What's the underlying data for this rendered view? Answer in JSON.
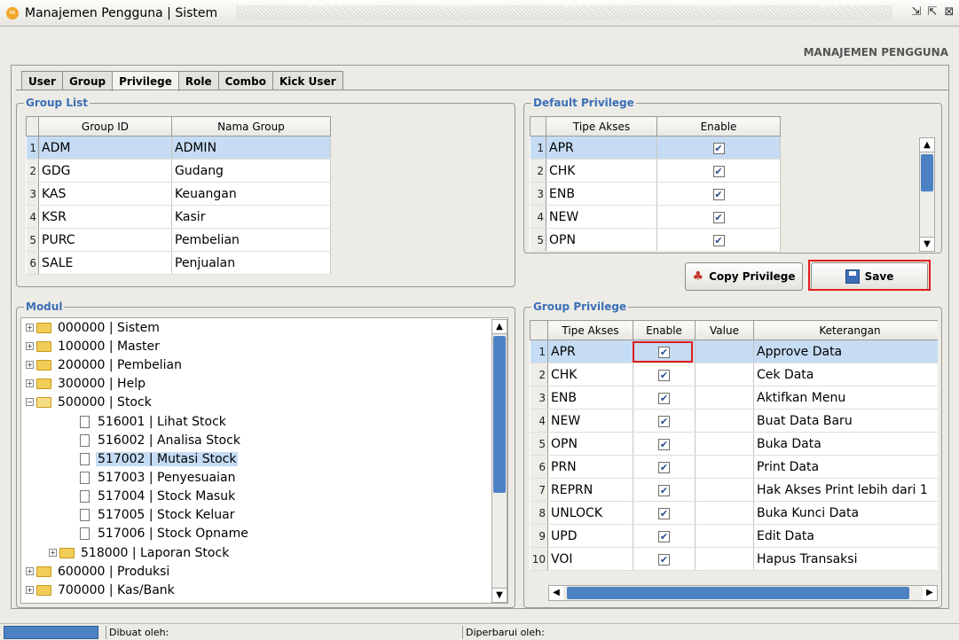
{
  "window": {
    "title": "Manajemen Pengguna | Sistem",
    "restore_glyph": "⇲",
    "max_glyph": "⇱",
    "close_glyph": "⊠"
  },
  "header": {
    "label": "MANAJEMEN PENGGUNA"
  },
  "tabs": [
    {
      "label": "User"
    },
    {
      "label": "Group"
    },
    {
      "label": "Privilege"
    },
    {
      "label": "Role"
    },
    {
      "label": "Combo"
    },
    {
      "label": "Kick User"
    }
  ],
  "group_list": {
    "title": "Group List",
    "columns": [
      "Group ID",
      "Nama Group"
    ],
    "rows": [
      {
        "n": "1",
        "id": "ADM",
        "name": "ADMIN"
      },
      {
        "n": "2",
        "id": "GDG",
        "name": "Gudang"
      },
      {
        "n": "3",
        "id": "KAS",
        "name": "Keuangan"
      },
      {
        "n": "4",
        "id": "KSR",
        "name": "Kasir"
      },
      {
        "n": "5",
        "id": "PURC",
        "name": "Pembelian"
      },
      {
        "n": "6",
        "id": "SALE",
        "name": "Penjualan"
      }
    ]
  },
  "default_privilege": {
    "title": "Default Privilege",
    "columns": [
      "Tipe Akses",
      "Enable"
    ],
    "rows": [
      {
        "n": "1",
        "type": "APR"
      },
      {
        "n": "2",
        "type": "CHK"
      },
      {
        "n": "3",
        "type": "ENB"
      },
      {
        "n": "4",
        "type": "NEW"
      },
      {
        "n": "5",
        "type": "OPN"
      }
    ]
  },
  "buttons": {
    "copy": "Copy Privilege",
    "save": "Save"
  },
  "modul": {
    "title": "Modul",
    "items": [
      {
        "label": "000000 | Sistem",
        "kind": "folder",
        "exp": "+"
      },
      {
        "label": "100000 | Master",
        "kind": "folder",
        "exp": "+"
      },
      {
        "label": "200000 | Pembelian",
        "kind": "folder",
        "exp": "+"
      },
      {
        "label": "300000 | Help",
        "kind": "folder",
        "exp": "+"
      },
      {
        "label": "500000 | Stock",
        "kind": "folder",
        "exp": "−"
      },
      {
        "label": "516001 | Lihat Stock",
        "kind": "doc"
      },
      {
        "label": "516002 | Analisa Stock",
        "kind": "doc"
      },
      {
        "label": "517002 | Mutasi Stock",
        "kind": "doc"
      },
      {
        "label": "517003 | Penyesuaian",
        "kind": "doc"
      },
      {
        "label": "517004 | Stock Masuk",
        "kind": "doc"
      },
      {
        "label": "517005 | Stock Keluar",
        "kind": "doc"
      },
      {
        "label": "517006 | Stock Opname",
        "kind": "doc"
      },
      {
        "label": "518000 | Laporan Stock",
        "kind": "subfolder",
        "exp": "+"
      },
      {
        "label": "600000 | Produksi",
        "kind": "folder",
        "exp": "+"
      },
      {
        "label": "700000 | Kas/Bank",
        "kind": "folder",
        "exp": "+"
      }
    ]
  },
  "group_privilege": {
    "title": "Group Privilege",
    "columns": [
      "Tipe Akses",
      "Enable",
      "Value",
      "Keterangan"
    ],
    "rows": [
      {
        "n": "1",
        "type": "APR",
        "value": "",
        "desc": "Approve Data"
      },
      {
        "n": "2",
        "type": "CHK",
        "value": "",
        "desc": "Cek Data"
      },
      {
        "n": "3",
        "type": "ENB",
        "value": "",
        "desc": "Aktifkan Menu"
      },
      {
        "n": "4",
        "type": "NEW",
        "value": "",
        "desc": "Buat Data Baru"
      },
      {
        "n": "5",
        "type": "OPN",
        "value": "",
        "desc": "Buka Data"
      },
      {
        "n": "6",
        "type": "PRN",
        "value": "",
        "desc": "Print Data"
      },
      {
        "n": "7",
        "type": "REPRN",
        "value": "",
        "desc": "Hak Akses Print lebih dari 1"
      },
      {
        "n": "8",
        "type": "UNLOCK",
        "value": "",
        "desc": "Buka Kunci Data"
      },
      {
        "n": "9",
        "type": "UPD",
        "value": "",
        "desc": "Edit Data"
      },
      {
        "n": "10",
        "type": "VOI",
        "value": "",
        "desc": "Hapus Transaksi"
      }
    ]
  },
  "status": {
    "created_by": "Dibuat oleh:",
    "updated_by": "Diperbarui oleh:"
  },
  "colors": {
    "accent": "#4c82c4",
    "selection": "#c5dcf4",
    "group_title": "#3b6fb6",
    "highlight": "#e01c1c"
  }
}
